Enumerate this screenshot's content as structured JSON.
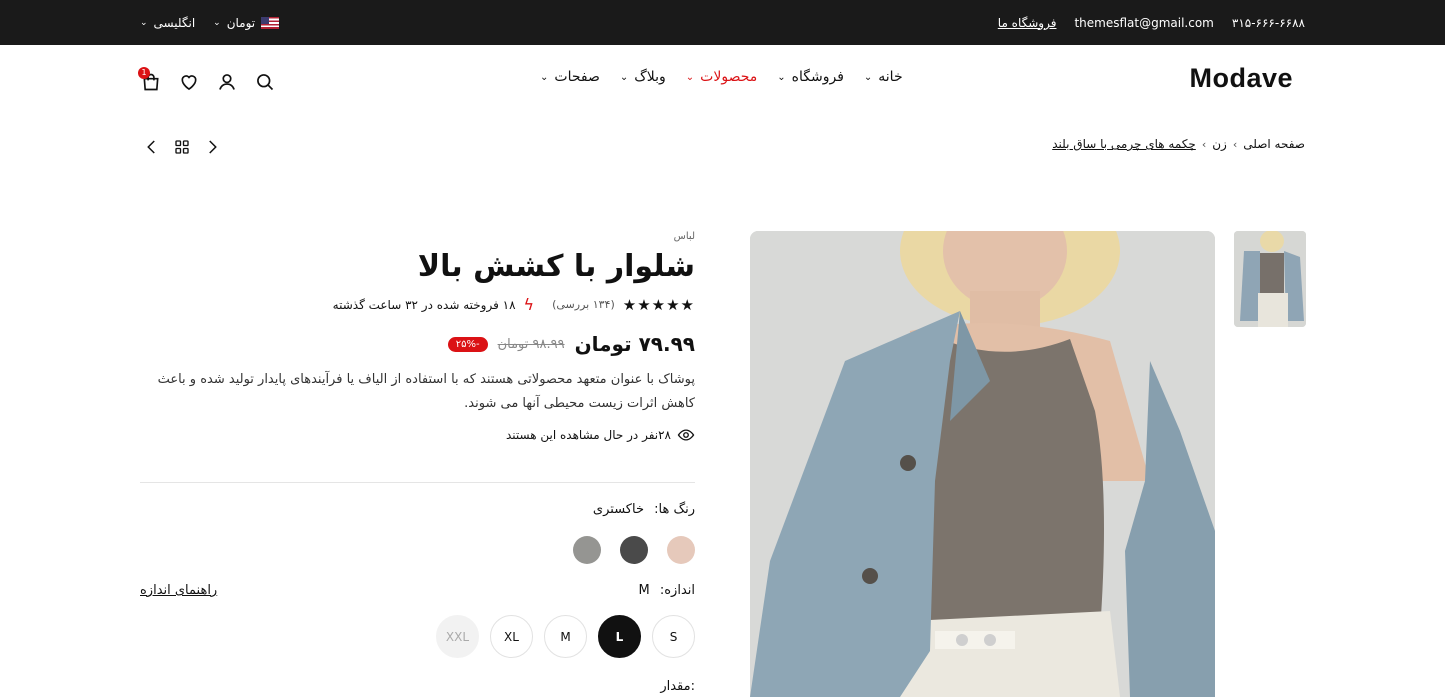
{
  "topbar": {
    "phone": "۳۱۵-۶۶۶-۶۶۸۸",
    "email": "themesflat@gmail.com",
    "store_link": "فروشگاه ما",
    "currency": "تومان",
    "language": "انگلیسی"
  },
  "header": {
    "logo": "Modave",
    "nav": [
      {
        "label": "خانه",
        "active": false
      },
      {
        "label": "فروشگاه",
        "active": false
      },
      {
        "label": "محصولات",
        "active": true
      },
      {
        "label": "وبلاگ",
        "active": false
      },
      {
        "label": "صفحات",
        "active": false
      }
    ],
    "cart_count": "1"
  },
  "breadcrumb": {
    "home": "صفحه اصلی",
    "category": "زن",
    "current": "چکمه های چرمی با ساق بلند"
  },
  "product": {
    "category": "لباس",
    "title": "شلوار با کشش بالا",
    "stars": "★★★★★",
    "reviews": "(۱۳۴ بررسی)",
    "sold": "۱۸ فروخته شده در ۳۲ ساعت گذشته",
    "price": "۷۹.۹۹ تومان",
    "old_price": "۹۸.۹۹ تومان",
    "discount": "-۲۵%",
    "description": "پوشاک با عنوان متعهد محصولاتی هستند که با استفاده از الیاف یا فرآیندهای پایدار تولید شده و باعث کاهش اثرات زیست محیطی آنها می شوند.",
    "viewing": "۲۸نفر در حال مشاهده این هستند"
  },
  "options": {
    "color_label": "رنگ ها:",
    "color_value": "خاکستری",
    "colors": [
      "#e6c9bb",
      "#4a4a4a",
      "#959592"
    ],
    "size_label": "اندازه:",
    "size_value": "M",
    "size_guide": "راهنمای اندازه",
    "sizes": [
      {
        "label": "S",
        "state": "normal"
      },
      {
        "label": "L",
        "state": "active"
      },
      {
        "label": "M",
        "state": "normal"
      },
      {
        "label": "XL",
        "state": "normal"
      },
      {
        "label": "XXL",
        "state": "disabled"
      }
    ],
    "quantity_label": "مقدار:"
  }
}
